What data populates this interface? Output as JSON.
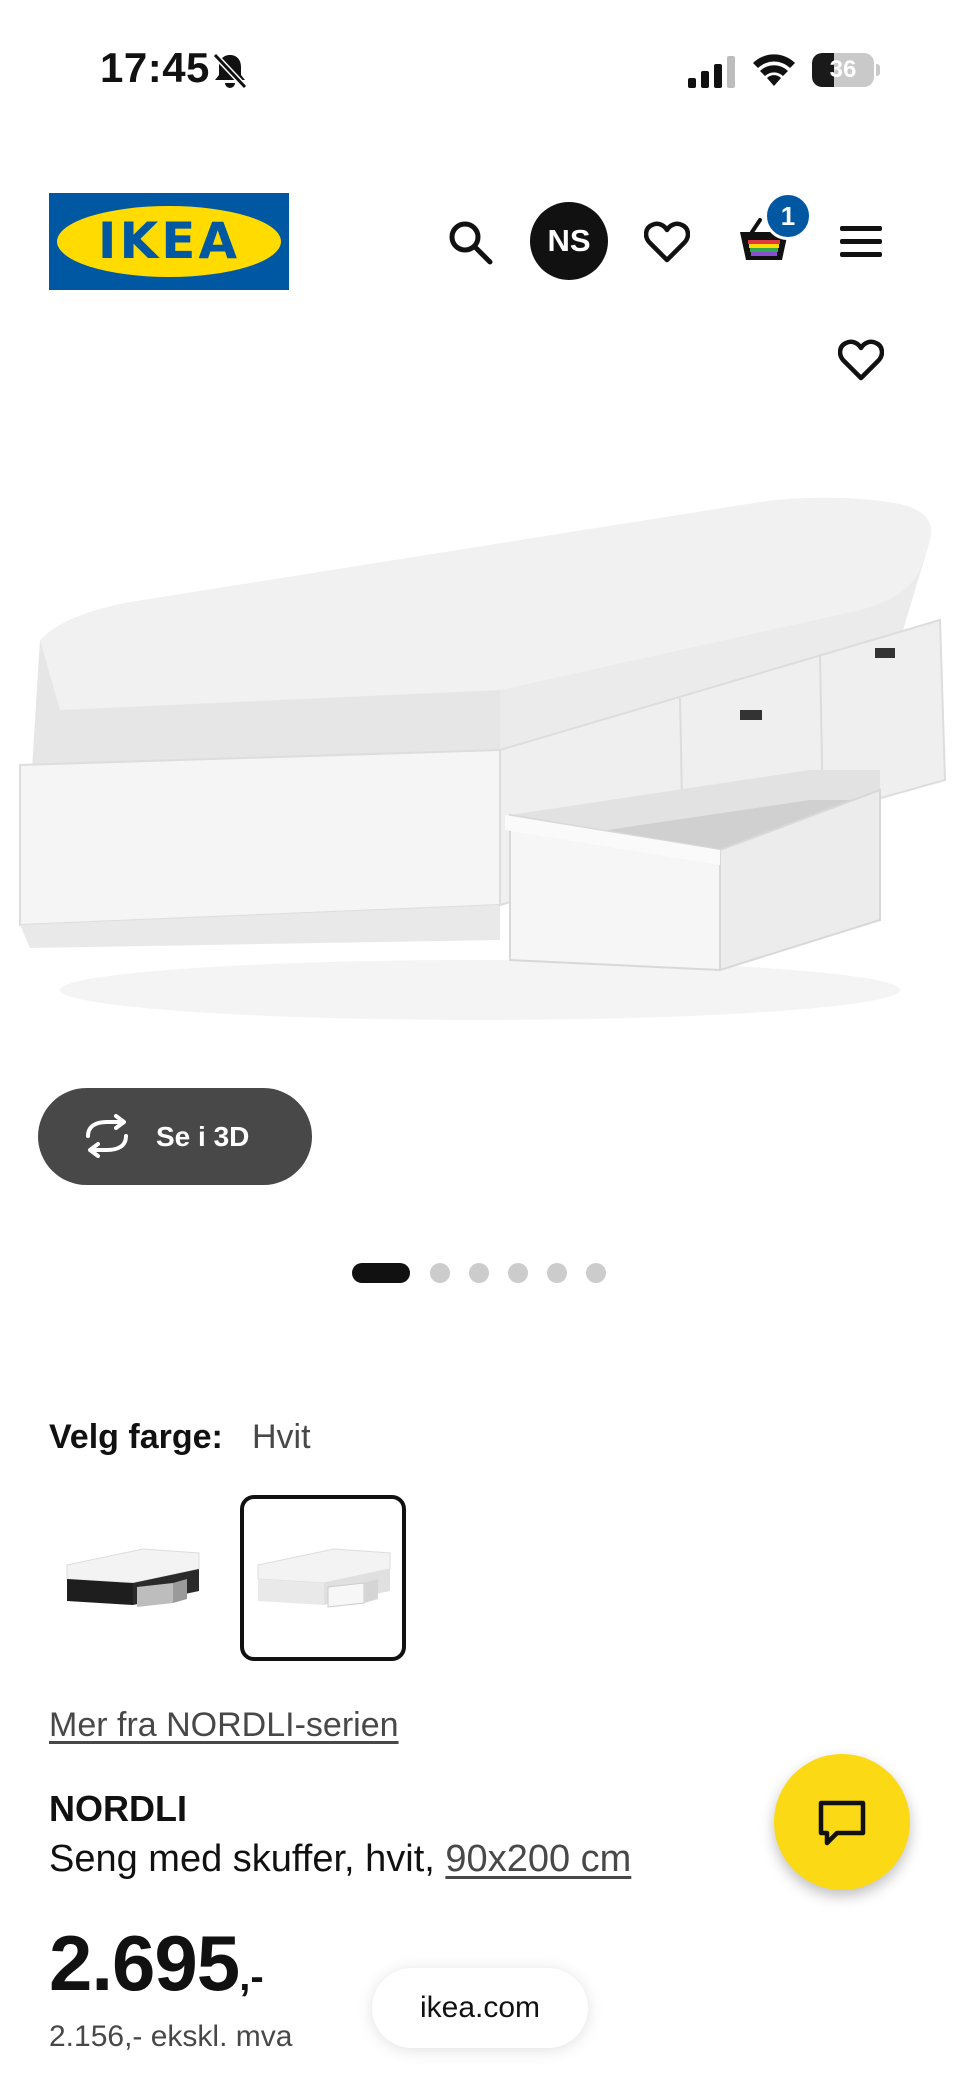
{
  "status_bar": {
    "time": "17:45",
    "battery": "36",
    "battery_level": 0.36,
    "icons": [
      "bell-slash-icon",
      "signal-icon",
      "wifi-icon",
      "battery-icon"
    ]
  },
  "header": {
    "logo": "IKEA",
    "avatar_initials": "NS",
    "cart_count": "1",
    "icons": [
      "search-icon",
      "heart-icon",
      "cart-icon",
      "menu-icon"
    ]
  },
  "gallery": {
    "view_3d_label": "Se i 3D",
    "image_count": 6,
    "active_index": 0
  },
  "color_picker": {
    "label": "Velg farge:",
    "selected": "Hvit",
    "options": [
      "black",
      "white"
    ]
  },
  "product": {
    "series_link": "Mer fra NORDLI-serien",
    "name": "NORDLI",
    "description": "Seng med skuffer, hvit,",
    "size": "90x200 cm",
    "price": "2.695",
    "price_suffix": ",-",
    "price_ex_vat": "2.156,- ekskl. mva"
  },
  "browser": {
    "url": "ikea.com"
  },
  "colors": {
    "ikea_blue": "#0058a3",
    "ikea_yellow": "#ffdb00",
    "chat_yellow": "#fbd914",
    "dark_button": "#484848"
  }
}
